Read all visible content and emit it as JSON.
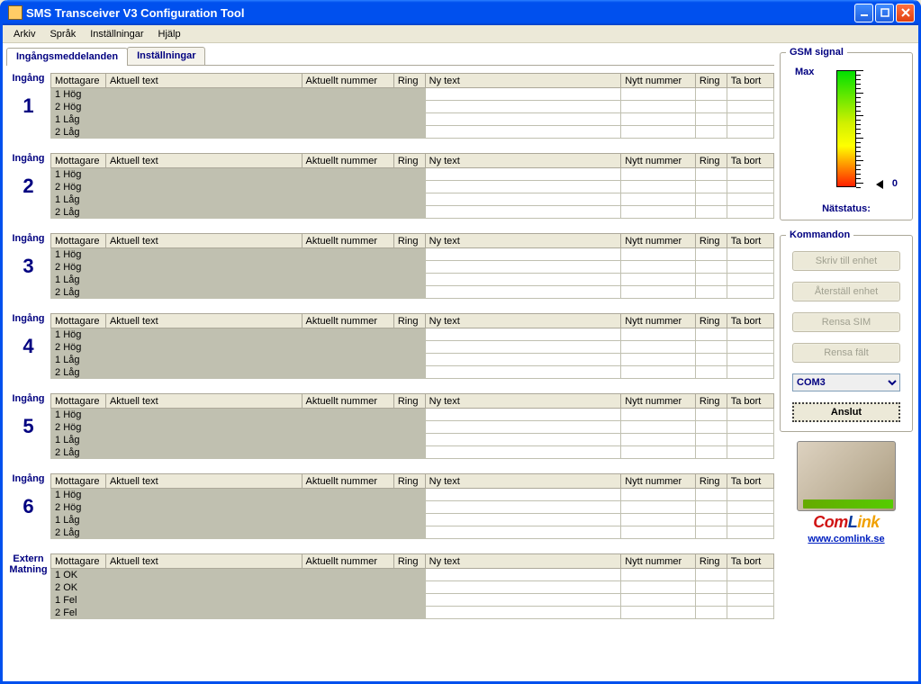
{
  "window": {
    "title": "SMS Transceiver V3 Configuration Tool"
  },
  "menu": {
    "items": [
      "Arkiv",
      "Språk",
      "Inställningar",
      "Hjälp"
    ]
  },
  "tabs": {
    "selected": 0,
    "items": [
      "Ingångsmeddelanden",
      "Inställningar"
    ]
  },
  "columns": {
    "mottagare": "Mottagare",
    "aktuell_text": "Aktuell text",
    "aktuellt_nummer": "Aktuellt nummer",
    "ring": "Ring",
    "ny_text": "Ny text",
    "nytt_nummer": "Nytt nummer",
    "ring2": "Ring",
    "ta_bort": "Ta bort"
  },
  "section_label": "Ingång",
  "extern_label_1": "Extern",
  "extern_label_2": "Matning",
  "std_rows": [
    "1 Hög",
    "2 Hög",
    "1 Låg",
    "2 Låg"
  ],
  "ext_rows": [
    "1 OK",
    "2 OK",
    "1 Fel",
    "2 Fel"
  ],
  "section_numbers": [
    "1",
    "2",
    "3",
    "4",
    "5",
    "6"
  ],
  "gsm": {
    "legend": "GSM signal",
    "max_label": "Max",
    "zero_label": "0",
    "net_label": "Nätstatus:"
  },
  "cmd": {
    "legend": "Kommandon",
    "write": "Skriv till enhet",
    "reset": "Återställ enhet",
    "clear_sim": "Rensa SIM",
    "clear_fields": "Rensa fält",
    "com_port": "COM3",
    "connect": "Anslut"
  },
  "brand": {
    "link_text": "www.comlink.se",
    "logo_a": "Com",
    "logo_b": "L",
    "logo_c": "ink"
  }
}
